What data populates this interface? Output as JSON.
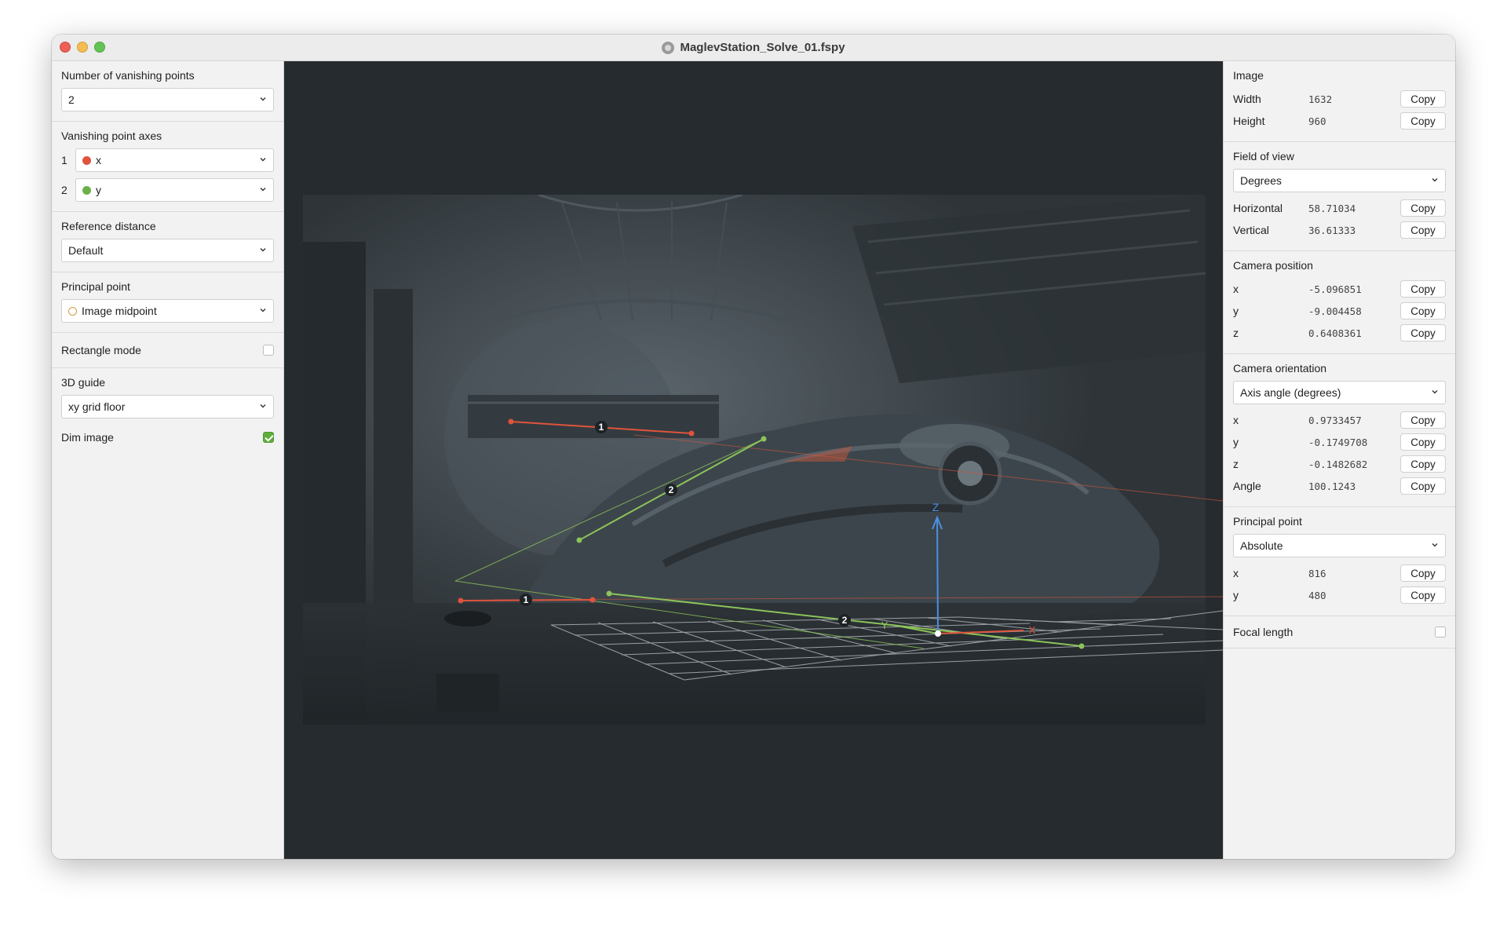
{
  "window": {
    "title": "MaglevStation_Solve_01.fspy"
  },
  "left": {
    "vanishing_points": {
      "label": "Number of vanishing points",
      "value": "2"
    },
    "axes": {
      "label": "Vanishing point axes",
      "items": [
        {
          "num": "1",
          "value": "x",
          "color": "#e0533c"
        },
        {
          "num": "2",
          "value": "y",
          "color": "#6bb04a"
        }
      ]
    },
    "reference_distance": {
      "label": "Reference distance",
      "value": "Default"
    },
    "principal_point": {
      "label": "Principal point",
      "value": "Image midpoint"
    },
    "rectangle_mode": {
      "label": "Rectangle mode",
      "checked": false
    },
    "guide": {
      "label": "3D guide",
      "value": "xy grid floor"
    },
    "dim_image": {
      "label": "Dim image",
      "checked": true
    }
  },
  "viewport": {
    "labels": {
      "vp1": "1",
      "vp2": "2",
      "axis_z": "Z",
      "axis_x": "X",
      "axis_y": "Y"
    },
    "colors": {
      "x_axis": "#e0533c",
      "y_axis": "#8cc35a",
      "z_axis": "#4a90e2"
    }
  },
  "right": {
    "copy_label": "Copy",
    "image": {
      "label": "Image",
      "rows": [
        {
          "k": "Width",
          "v": "1632"
        },
        {
          "k": "Height",
          "v": "960"
        }
      ]
    },
    "fov": {
      "label": "Field of view",
      "unit": "Degrees",
      "rows": [
        {
          "k": "Horizontal",
          "v": "58.71034"
        },
        {
          "k": "Vertical",
          "v": "36.61333"
        }
      ]
    },
    "camera_position": {
      "label": "Camera position",
      "rows": [
        {
          "k": "x",
          "v": "-5.096851"
        },
        {
          "k": "y",
          "v": "-9.004458"
        },
        {
          "k": "z",
          "v": "0.6408361"
        }
      ]
    },
    "camera_orientation": {
      "label": "Camera orientation",
      "mode": "Axis angle (degrees)",
      "rows": [
        {
          "k": "x",
          "v": "0.9733457"
        },
        {
          "k": "y",
          "v": "-0.1749708"
        },
        {
          "k": "z",
          "v": "-0.1482682"
        },
        {
          "k": "Angle",
          "v": "100.1243"
        }
      ]
    },
    "principal_point": {
      "label": "Principal point",
      "mode": "Absolute",
      "rows": [
        {
          "k": "x",
          "v": "816"
        },
        {
          "k": "y",
          "v": "480"
        }
      ]
    },
    "focal_length": {
      "label": "Focal length",
      "checked": false
    }
  }
}
